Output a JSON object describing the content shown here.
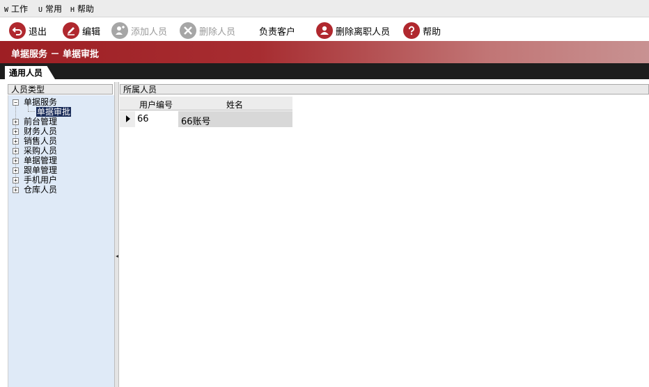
{
  "menu": [
    {
      "key": "W",
      "label": "工作"
    },
    {
      "key": "U",
      "label": "常用"
    },
    {
      "key": "H",
      "label": "帮助"
    }
  ],
  "toolbar": {
    "exit": "退出",
    "edit": "编辑",
    "add_person": "添加人员",
    "delete_person": "删除人员",
    "responsible_customer": "负责客户",
    "delete_resigned": "删除离职人员",
    "help": "帮助"
  },
  "banner": {
    "title": "单据服务 － 单据审批"
  },
  "tabs": {
    "active": "通用人员"
  },
  "left_panel": {
    "header": "人员类型",
    "tree": [
      {
        "label": "单据服务",
        "expanded": true,
        "children": [
          {
            "label": "单据审批",
            "selected": true
          }
        ]
      },
      {
        "label": "前台管理"
      },
      {
        "label": "财务人员"
      },
      {
        "label": "销售人员"
      },
      {
        "label": "采购人员"
      },
      {
        "label": "单据管理"
      },
      {
        "label": "跟单管理"
      },
      {
        "label": "手机用户"
      },
      {
        "label": "仓库人员"
      }
    ]
  },
  "right_panel": {
    "header": "所属人员",
    "columns": [
      "用户编号",
      "姓名"
    ],
    "rows": [
      [
        "66",
        "66账号"
      ]
    ]
  },
  "colors": {
    "brand": "#b0282e",
    "selection": "#1b2d5a",
    "tree_bg": "#dfeaf7"
  },
  "icons": {
    "exit": "back-arrow-icon",
    "edit": "pencil-icon",
    "add_person": "add-user-icon",
    "delete_person": "delete-x-icon",
    "delete_resigned": "user-remove-icon",
    "help": "question-icon"
  }
}
